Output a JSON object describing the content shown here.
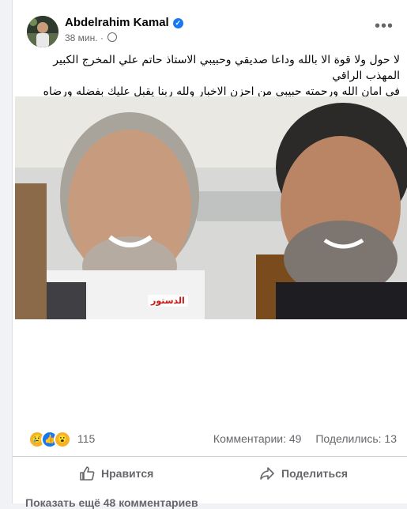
{
  "post": {
    "author": "Abdelrahim Kamal",
    "time": "38 мин.",
    "text_line1": "لا حول ولا قوة الا بالله وداعا صديقي وحبيبي الاستاذ حاتم علي المخرج الكبير المهذب الراقي",
    "text_line2": "في امان الله ورحمته حبيبي من احزن الاخبار ولله ربنا يقبل عليك بفضله ورضاه",
    "watermark": "الدستور"
  },
  "stats": {
    "reactions_count": "115",
    "comments": "Комментарии: 49",
    "shares": "Поделились: 13"
  },
  "actions": {
    "like": "Нравится",
    "share": "Поделиться"
  },
  "footer": {
    "more_comments": "Показать ещё 48 комментариев"
  },
  "icons": {
    "verified": "verified-badge-icon",
    "privacy": "globe-icon",
    "more": "more-options-icon",
    "reaction_1": "sad-reaction-icon",
    "reaction_2": "like-reaction-icon",
    "reaction_3": "wow-reaction-icon"
  },
  "colors": {
    "accent": "#1877f2",
    "muted": "#65676b",
    "watermark": "#c81919"
  }
}
